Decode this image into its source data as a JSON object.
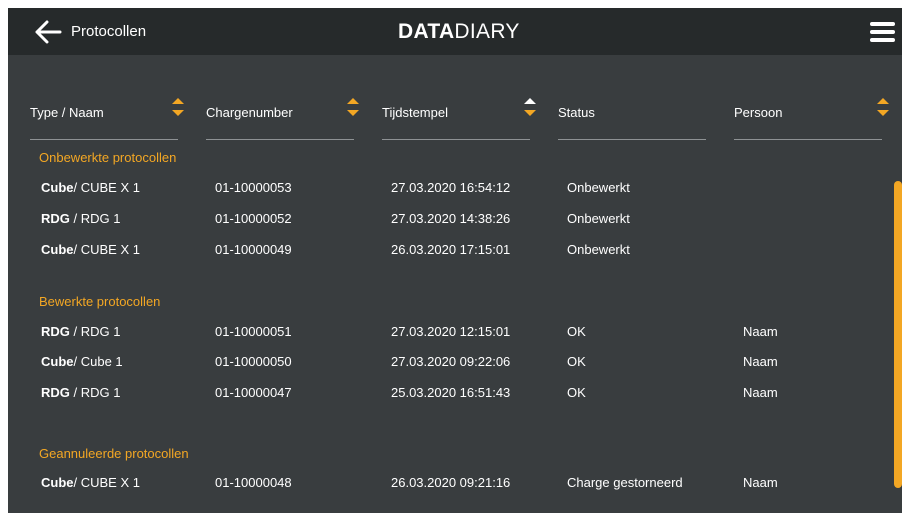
{
  "topbar": {
    "title": "Protocollen",
    "logo_bold": "DATA",
    "logo_light": "DIARY",
    "back_icon": "arrow-left-icon",
    "menu_icon": "hamburger-menu-icon"
  },
  "columns": [
    "Type / Naam",
    "Chargenumber",
    "Tijdstempel",
    "Status",
    "Persoon"
  ],
  "sections": [
    {
      "title": "Onbewerkte protocollen",
      "rows": [
        {
          "type": "Cube",
          "name": "/ CUBE X 1",
          "charge": "01-10000053",
          "time": "27.03.2020 16:54:12",
          "status": "Onbewerkt",
          "person": ""
        },
        {
          "type": "RDG",
          "name": " / RDG 1",
          "charge": "01-10000052",
          "time": "27.03.2020 14:38:26",
          "status": "Onbewerkt",
          "person": ""
        },
        {
          "type": "Cube",
          "name": "/ CUBE X 1",
          "charge": "01-10000049",
          "time": "26.03.2020 17:15:01",
          "status": "Onbewerkt",
          "person": ""
        }
      ]
    },
    {
      "title": "Bewerkte protocollen",
      "rows": [
        {
          "type": "RDG",
          "name": " / RDG 1",
          "charge": "01-10000051",
          "time": "27.03.2020 12:15:01",
          "status": "OK",
          "person": "Naam"
        },
        {
          "type": "Cube",
          "name": "/ Cube 1",
          "charge": "01-10000050",
          "time": "27.03.2020 09:22:06",
          "status": "OK",
          "person": "Naam"
        },
        {
          "type": "RDG",
          "name": " / RDG 1",
          "charge": "01-10000047",
          "time": "25.03.2020 16:51:43",
          "status": "OK",
          "person": "Naam"
        }
      ]
    },
    {
      "title": "Geannuleerde protocollen",
      "rows": [
        {
          "type": "Cube",
          "name": "/ CUBE X 1",
          "charge": "01-10000048",
          "time": "26.03.2020 09:21:16",
          "status": "Charge gestorneerd",
          "person": "Naam"
        }
      ]
    }
  ],
  "colors": {
    "background": "#393d3f",
    "topbar": "#262a2b",
    "accent": "#f3a724",
    "text": "#ffffff"
  }
}
